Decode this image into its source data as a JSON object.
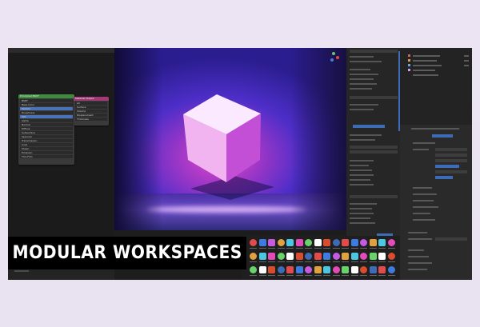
{
  "banner": {
    "title": "MODULAR WORKSPACES"
  },
  "node_editor": {
    "node_a_title": "Principled BSDF",
    "node_a_rows": [
      "BSDF",
      "Base Color",
      "Metallic",
      "Roughness",
      "IOR",
      "Alpha",
      "Normal",
      "Diffuse",
      "Subsurface",
      "Specular",
      "Transmission",
      "Coat",
      "Sheen",
      "Emission",
      "Thin Film"
    ],
    "node_b_title": "Material Output",
    "node_b_rows": [
      "All",
      "Surface",
      "Volume",
      "Displacement",
      "Thickness"
    ]
  },
  "viewport": {
    "colors": {
      "cube_top": "#fbe9ff",
      "cube_left": "#f1b4f0",
      "cube_right": "#c24fd6",
      "background": "#4d2ec8"
    }
  },
  "asset_colors": [
    "#e24b4b",
    "#3e7be0",
    "#c65ae0",
    "#e0a23e",
    "#4bc7e2",
    "#e24bb8",
    "#68d36a",
    "#ffffff",
    "#d94c2e",
    "#3e6bb5"
  ]
}
